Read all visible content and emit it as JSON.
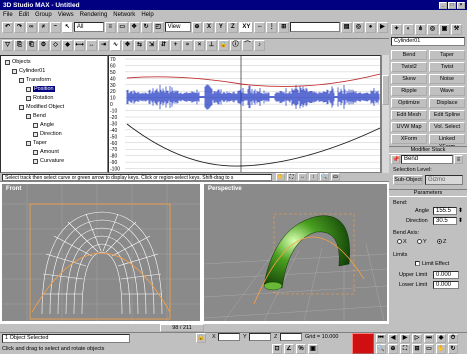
{
  "window": {
    "title": "3D Studio MAX - Untitled"
  },
  "menu": [
    "File",
    "Edit",
    "Group",
    "Views",
    "Rendering",
    "Network",
    "Help"
  ],
  "toolbar": {
    "filter_value": "All",
    "view_value": "View",
    "axis_x": "X",
    "axis_y": "Y",
    "axis_z": "Z",
    "axis_xy": "XY",
    "view2_value": "View"
  },
  "tree": [
    {
      "label": "Objects",
      "level": 0
    },
    {
      "label": "Cylinder01",
      "level": 1
    },
    {
      "label": "Transform",
      "level": 2
    },
    {
      "label": "Position",
      "level": 3,
      "selected": true
    },
    {
      "label": "Rotation",
      "level": 3
    },
    {
      "label": "Modified Object",
      "level": 2
    },
    {
      "label": "Bend",
      "level": 3
    },
    {
      "label": "Angle",
      "level": 4
    },
    {
      "label": "Direction",
      "level": 4
    },
    {
      "label": "Taper",
      "level": 3
    },
    {
      "label": "Amount",
      "level": 4
    },
    {
      "label": "Curvature",
      "level": 4
    }
  ],
  "graph": {
    "y_ticks": [
      "70",
      "60",
      "50",
      "40",
      "30",
      "20",
      "10",
      "0",
      "-10",
      "-20",
      "-30",
      "-40",
      "-50",
      "-60",
      "-70",
      "-80",
      "-90",
      "-100"
    ]
  },
  "status_hint": "Select track then select curve or green arrow to display keys. Click or region-select keys. Shift-drag to s",
  "viewports": {
    "front": "Front",
    "perspective": "Perspective"
  },
  "timeslider": "98 / 211",
  "command_panel": {
    "object_name": "Cylinder01",
    "modifier_buttons": [
      "Bend",
      "Taper",
      "Twist2",
      "Twist",
      "Skew",
      "Noise",
      "Ripple",
      "Wave",
      "Optimize",
      "Displace",
      "Edit Mesh",
      "Edit Spline",
      "UVW Map",
      "Vol. Select",
      "XForm",
      "Linked XForm"
    ],
    "modifier_stack_header": "Modifier Stack",
    "stack_value": "Bend",
    "selection_level_label": "Selection Level:",
    "sub_object_label": "Sub-Object",
    "sub_object_value": "Gizmo",
    "parameters_header": "Parameters",
    "bend_label": "Bend:",
    "angle_label": "Angle",
    "angle_value": "155.5",
    "direction_label": "Direction",
    "direction_value": "30.5",
    "bend_axis_label": "Bend Axis:",
    "axis_options": [
      "X",
      "Y",
      "Z"
    ],
    "axis_selected": "Z",
    "limits_label": "Limits",
    "limit_effect_label": "Limit Effect",
    "upper_limit_label": "Upper Limit",
    "upper_limit_value": "0.000",
    "lower_limit_label": "Lower Limit",
    "lower_limit_value": "0.000"
  },
  "status": {
    "selected": "1 Object Selected",
    "prompt": "Click and drag to select and rotate objects",
    "grid": "Grid = 10.000",
    "x_label": "X",
    "y_label": "Y",
    "z_label": "Z"
  }
}
